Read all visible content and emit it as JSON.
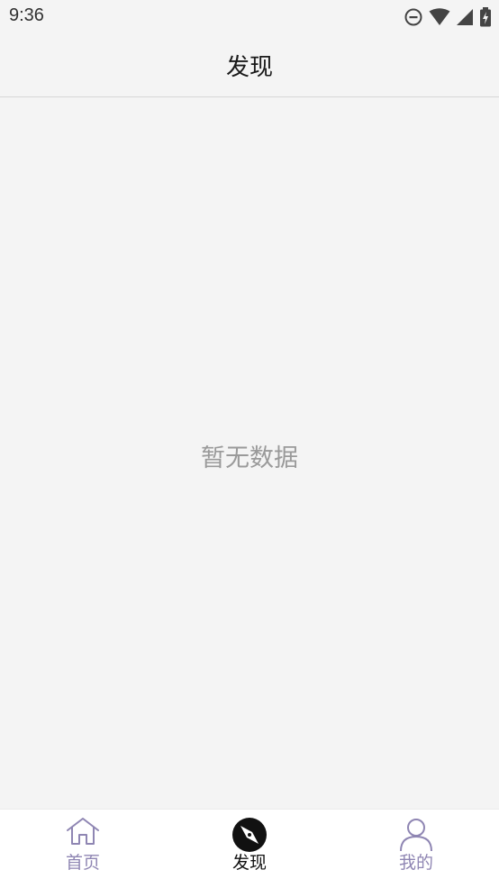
{
  "status_bar": {
    "time": "9:36",
    "icons": [
      "do-not-disturb-icon",
      "wifi-icon",
      "signal-icon",
      "battery-charging-icon"
    ]
  },
  "header": {
    "title": "发现"
  },
  "main": {
    "empty_text": "暂无数据"
  },
  "tab_bar": {
    "tabs": [
      {
        "label": "首页",
        "icon": "home-icon",
        "active": false
      },
      {
        "label": "发现",
        "icon": "compass-icon",
        "active": true
      },
      {
        "label": "我的",
        "icon": "user-icon",
        "active": false
      }
    ]
  },
  "colors": {
    "background": "#f4f4f4",
    "tab_inactive": "#8f86b3",
    "tab_active": "#111111",
    "empty_text": "#9a9a9a"
  }
}
